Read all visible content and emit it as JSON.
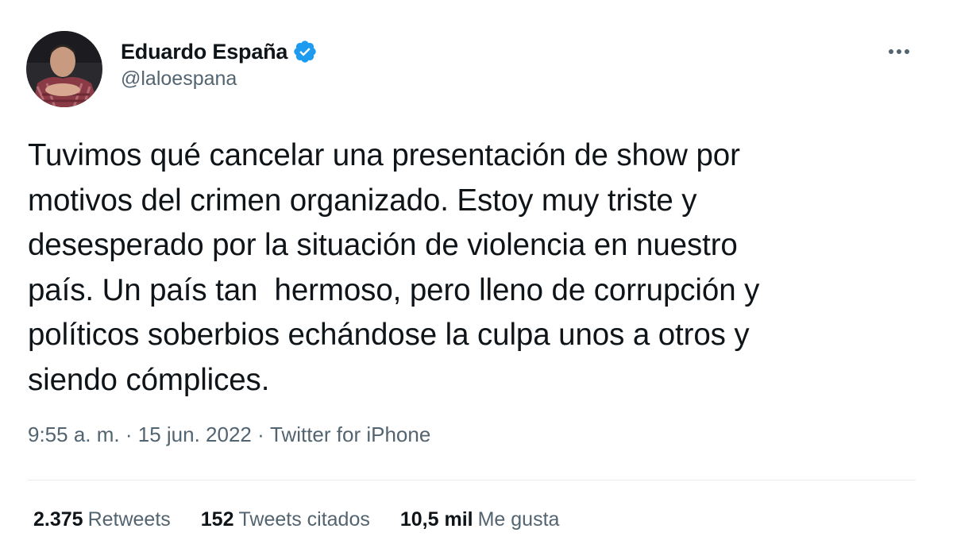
{
  "author": {
    "display_name": "Eduardo España",
    "handle": "@laloespana",
    "verified": true,
    "avatar_icon": "profile-photo"
  },
  "tweet": {
    "text": "Tuvimos qué cancelar una presentación de show por\nmotivos del crimen organizado. Estoy muy triste y\ndesesperado por la situación de violencia en nuestro\npaís. Un país tan  hermoso, pero lleno de corrupción y\npolíticos soberbios echándose la culpa unos a otros y\nsiendo cómplices."
  },
  "meta": {
    "time": "9:55 a. m.",
    "separator": " · ",
    "date": "15 jun. 2022",
    "source": "Twitter for iPhone"
  },
  "stats": {
    "retweets": {
      "count": "2.375",
      "label": "Retweets"
    },
    "quotes": {
      "count": "152",
      "label": "Tweets citados"
    },
    "likes": {
      "count": "10,5 mil",
      "label": "Me gusta"
    }
  },
  "icons": {
    "verified": "verified-badge-icon",
    "more": "more-options-icon"
  },
  "colors": {
    "verified_blue": "#1d9bf0",
    "text_primary": "#0f1419",
    "text_secondary": "#536471",
    "divider": "#e6ecf0"
  }
}
